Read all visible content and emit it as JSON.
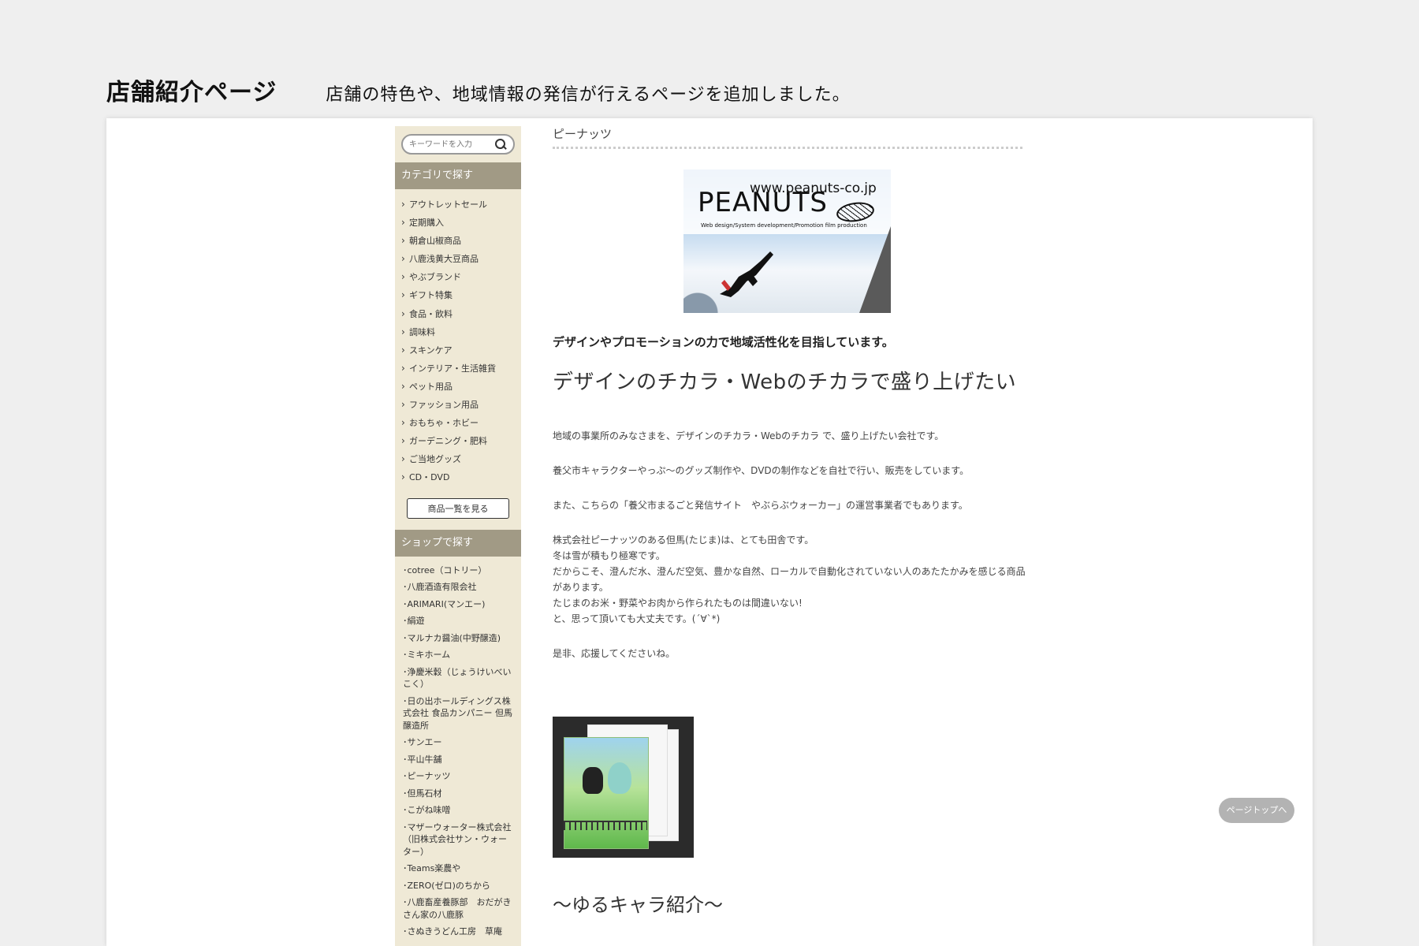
{
  "page": {
    "title": "店舗紹介ページ",
    "description": "店舗の特色や、地域情報の発信が行えるページを追加しました。"
  },
  "sidebar": {
    "search_placeholder": "キーワードを入力",
    "category_header": "カテゴリで探す",
    "categories": [
      "アウトレットセール",
      "定期購入",
      "朝倉山椒商品",
      "八鹿浅黄大豆商品",
      "やぶブランド",
      "ギフト特集",
      "食品・飲料",
      "調味料",
      "スキンケア",
      "インテリア・生活雑貨",
      "ペット用品",
      "ファッション用品",
      "おもちゃ・ホビー",
      "ガーデニング・肥料",
      "ご当地グッズ",
      "CD・DVD"
    ],
    "all_products_button": "商品一覧を見る",
    "shop_header": "ショップで探す",
    "shops": [
      "･cotree（コトリー）",
      "･八鹿酒造有限会社",
      "･ARIMARI(マンエー)",
      "･絹遊",
      "･マルナカ醤油(中野醸造)",
      "･ミキホーム",
      "･浄慶米穀（じょうけいべいこく）",
      "･日の出ホールディングス株式会社 食品カンパニー 但馬醸造所",
      "･サンエー",
      "･平山牛舗",
      "･ピーナッツ",
      "･但馬石材",
      "･こがね味噌",
      "･マザーウォーター株式会社（旧株式会社サン・ウォーター）",
      "･Teams楽農や",
      "･ZERO(ゼロ)のちから",
      "･八鹿畜産養豚部　おだがきさん家の八鹿豚",
      "･さぬきうどん工房　草庵"
    ]
  },
  "main": {
    "shop_name": "ピーナッツ",
    "hero": {
      "url": "www.peanuts-co.jp",
      "brand": "PEANUTS",
      "tagline": "Web design/System development/Promotion film production"
    },
    "lead": "デザインやプロモーションの力で地域活性化を目指しています。",
    "headline": "デザインのチカラ・Webのチカラで盛り上げたい",
    "paragraphs": [
      "地域の事業所のみなさまを、デザインのチカラ・Webのチカラ で、盛り上げたい会社です。",
      "養父市キャラクターやっぷ〜のグッズ制作や、DVDの制作などを自社で行い、販売をしています。",
      "また、こちらの「養父市まるごと発信サイト　やぶらぶウォーカー」の運営事業者でもあります。",
      "株式会社ピーナッツのある但馬(たじま)は、とても田舎です。\n冬は雪が積もり極寒です。\nだからこそ、澄んだ水、澄んだ空気、豊かな自然、ローカルで自動化されていない人のあたたかみを感じる商品があります。\nたじまのお米・野菜やお肉から作られたものは間違いない!\nと、思って頂いても大丈夫です。(´∀`*)",
      "是非、応援してくださいね。"
    ],
    "section_title": "〜ゆるキャラ紹介〜"
  },
  "page_top_button": "ページトップへ"
}
